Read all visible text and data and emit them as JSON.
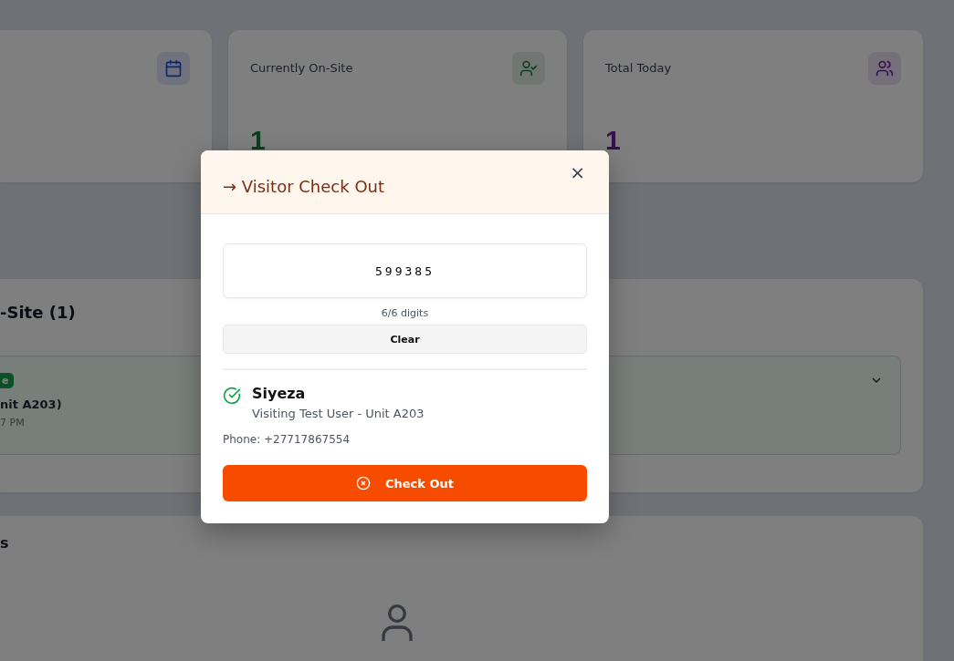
{
  "stats": [
    {
      "label": "Currently On-Site",
      "value": "1"
    },
    {
      "label": "Total Today",
      "value": "1"
    }
  ],
  "onsite_panel": {
    "title": "-Site (1)",
    "visitor": {
      "badge": "e",
      "host": "nit A203)",
      "time": "7 PM"
    }
  },
  "lower_panel": {
    "title": "s"
  },
  "modal": {
    "title": "→ Visitor Check Out",
    "close": "×",
    "code": {
      "value": "599385"
    },
    "digits": "6/6 digits",
    "clear_button": "Clear",
    "visitor": {
      "name": "Siyeza",
      "detail": "Visiting Test User - Unit A203",
      "phone": "Phone: +27717867554"
    },
    "checkout_button": "Check Out"
  }
}
